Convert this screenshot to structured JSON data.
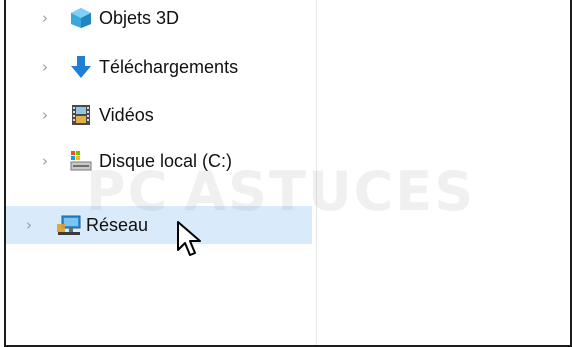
{
  "tree": {
    "items": [
      {
        "label": "Objets 3D",
        "icon": "objects-3d-icon"
      },
      {
        "label": "Téléchargements",
        "icon": "downloads-icon"
      },
      {
        "label": "Vidéos",
        "icon": "videos-icon"
      },
      {
        "label": "Disque local (C:)",
        "icon": "local-disk-icon"
      },
      {
        "label": "Réseau",
        "icon": "network-icon"
      }
    ],
    "chevron": "›"
  },
  "watermark": {
    "text_left": "PC",
    "text_right": "ASTUCES"
  },
  "colors": {
    "hover": "#d9ebfb",
    "border": "#1c1c1c"
  }
}
